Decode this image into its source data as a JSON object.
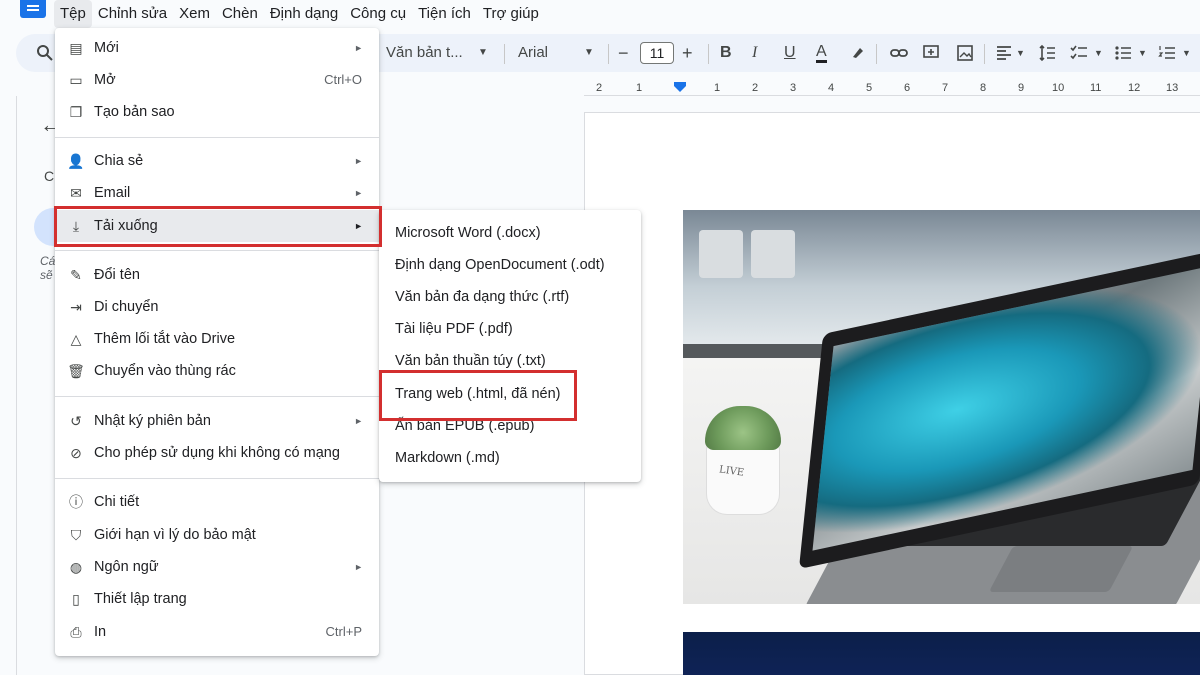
{
  "menubar": [
    "Tệp",
    "Chỉnh sửa",
    "Xem",
    "Chèn",
    "Định dạng",
    "Công cụ",
    "Tiện ích",
    "Trợ giúp"
  ],
  "toolbar": {
    "style_label": "Văn bản t...",
    "font_label": "Arial",
    "font_size": "11",
    "minus": "−",
    "plus": "+",
    "bold": "B",
    "italic": "I",
    "underline": "U",
    "text_color": "A"
  },
  "ruler": [
    "2",
    "1",
    "1",
    "1",
    "2",
    "3",
    "4",
    "5",
    "6",
    "7",
    "8",
    "9",
    "10",
    "11",
    "12",
    "13"
  ],
  "left_panel": {
    "c_letter": "C",
    "frag1": "Cá",
    "frag2": "sẽ"
  },
  "file_menu": {
    "items": [
      {
        "label": "Mới",
        "icon": "doc-icon",
        "shortcut": "",
        "submenu": true
      },
      {
        "label": "Mở",
        "icon": "folder-icon",
        "shortcut": "Ctrl+O",
        "submenu": false
      },
      {
        "label": "Tạo bản sao",
        "icon": "copy-icon",
        "shortcut": "",
        "submenu": false
      },
      {
        "label": "Chia sẻ",
        "icon": "person-add-icon",
        "shortcut": "",
        "submenu": true
      },
      {
        "label": "Email",
        "icon": "mail-icon",
        "shortcut": "",
        "submenu": true
      },
      {
        "label": "Tải xuống",
        "icon": "download-icon",
        "shortcut": "",
        "submenu": true,
        "highlighted": true
      },
      {
        "label": "Đổi tên",
        "icon": "pencil-icon",
        "shortcut": "",
        "submenu": false
      },
      {
        "label": "Di chuyển",
        "icon": "move-folder-icon",
        "shortcut": "",
        "submenu": false
      },
      {
        "label": "Thêm lối tắt vào Drive",
        "icon": "drive-shortcut-icon",
        "shortcut": "",
        "submenu": false
      },
      {
        "label": "Chuyển vào thùng rác",
        "icon": "trash-icon",
        "shortcut": "",
        "submenu": false
      },
      {
        "label": "Nhật ký phiên bản",
        "icon": "history-icon",
        "shortcut": "",
        "submenu": true
      },
      {
        "label": "Cho phép sử dụng khi không có mạng",
        "icon": "offline-icon",
        "shortcut": "",
        "submenu": false
      },
      {
        "label": "Chi tiết",
        "icon": "info-icon",
        "shortcut": "",
        "submenu": false
      },
      {
        "label": "Giới hạn vì lý do bảo mật",
        "icon": "security-icon",
        "shortcut": "",
        "submenu": false
      },
      {
        "label": "Ngôn ngữ",
        "icon": "globe-icon",
        "shortcut": "",
        "submenu": true
      },
      {
        "label": "Thiết lập trang",
        "icon": "page-setup-icon",
        "shortcut": "",
        "submenu": false
      },
      {
        "label": "In",
        "icon": "printer-icon",
        "shortcut": "Ctrl+P",
        "submenu": false
      }
    ]
  },
  "download_submenu": {
    "items": [
      "Microsoft Word (.docx)",
      "Định dạng OpenDocument (.odt)",
      "Văn bản đa dạng thức (.rtf)",
      "Tài liệu PDF (.pdf)",
      "Văn bản thuần túy (.txt)",
      "Trang web (.html, đã nén)",
      "Ấn bản EPUB (.epub)",
      "Markdown (.md)"
    ],
    "highlighted_index": 5
  },
  "photo": {
    "pot_text": "LIVE"
  },
  "colors": {
    "accent": "#1a73e8",
    "highlight_box": "#d32f2f",
    "menu_hover": "#e8eaed"
  }
}
